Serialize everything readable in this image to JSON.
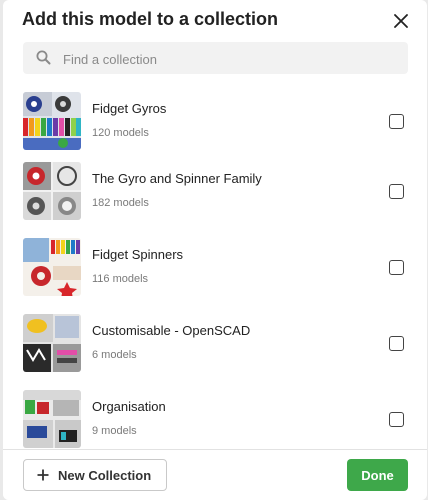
{
  "dialog": {
    "title": "Add this model to a collection",
    "close_icon": "close-icon"
  },
  "search": {
    "placeholder": "Find a collection",
    "value": "",
    "icon": "search-icon"
  },
  "collections": [
    {
      "name": "Fidget Gyros",
      "count": "120 models",
      "checked": false
    },
    {
      "name": "The Gyro and Spinner Family",
      "count": "182 models",
      "checked": false
    },
    {
      "name": "Fidget Spinners",
      "count": "116 models",
      "checked": false
    },
    {
      "name": "Customisable - OpenSCAD",
      "count": "6 models",
      "checked": false
    },
    {
      "name": "Organisation",
      "count": "9 models",
      "checked": false
    }
  ],
  "footer": {
    "new_collection_label": "New Collection",
    "new_collection_icon": "plus-icon",
    "done_label": "Done"
  },
  "colors": {
    "done_button": "#3ea84a",
    "search_background": "#f2f2f2"
  }
}
